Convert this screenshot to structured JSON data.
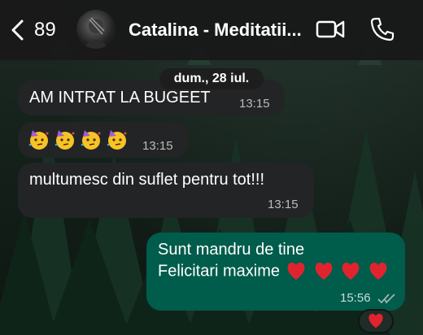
{
  "header": {
    "unread_count": "89",
    "contact_name": "Catalina - Meditatii..."
  },
  "chat": {
    "date_separator": "dum., 28 iul.",
    "messages": [
      {
        "direction": "incoming",
        "text": "AM INTRAT LA BUGEET",
        "time": "13:15"
      },
      {
        "direction": "incoming",
        "emoji": [
          "partying-face",
          "partying-face",
          "partying-face",
          "partying-face"
        ],
        "time": "13:15"
      },
      {
        "direction": "incoming",
        "text": "multumesc din suflet pentru tot!!!",
        "time": "13:15"
      },
      {
        "direction": "outgoing",
        "line1": "Sunt mandru de tine",
        "line2": "Felicitari maxime",
        "hearts": 4,
        "time": "15:56",
        "status": "read"
      }
    ],
    "reaction": "red-heart"
  },
  "colors": {
    "header_bg": "#181818",
    "incoming_bubble": "#232425",
    "outgoing_bubble": "#005c4b",
    "read_ticks": "#9fb3ad",
    "heart": "#e0242e"
  }
}
